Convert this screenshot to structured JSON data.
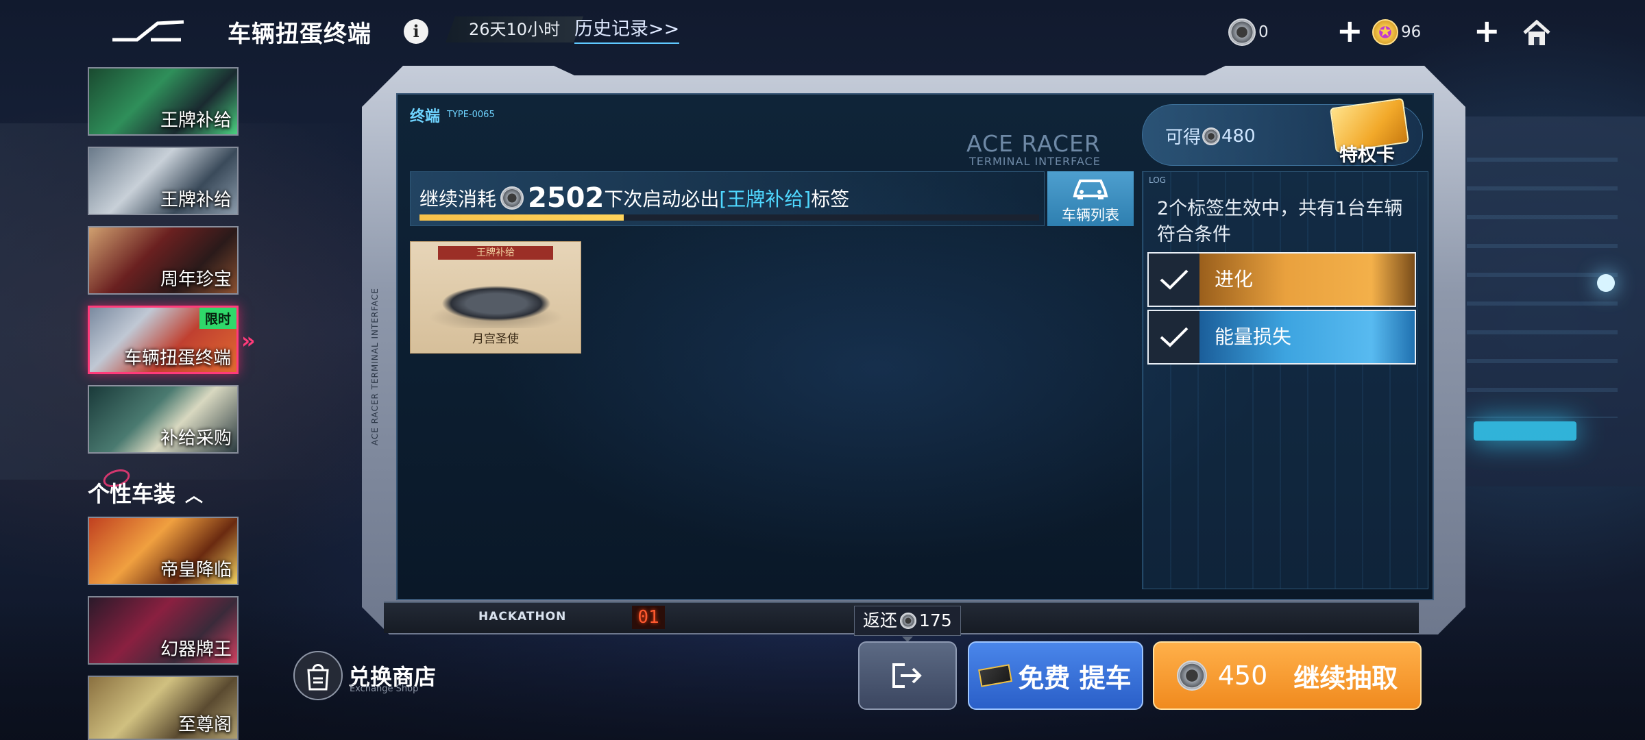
{
  "header": {
    "title": "车辆扭蛋终端",
    "timer": "26天10小时",
    "history_link": "历史记录>>",
    "coins_value": "0",
    "stars_value": "96",
    "coin_icon": "silver-coin-icon",
    "star_icon": "purple-star-coin-icon",
    "plus_symbol": "+",
    "home_icon": "home-icon"
  },
  "sidebar": {
    "items": [
      {
        "label": "王牌补给",
        "active": false
      },
      {
        "label": "王牌补给",
        "active": false
      },
      {
        "label": "周年珍宝",
        "active": false
      },
      {
        "label": "车辆扭蛋终端",
        "active": true,
        "tag": "限时"
      },
      {
        "label": "补给采购",
        "active": false
      }
    ],
    "section_title": "个性车装",
    "section_items": [
      {
        "label": "帝皇降临"
      },
      {
        "label": "幻器牌王"
      },
      {
        "label": "至尊阁"
      }
    ],
    "active_arrow": "»"
  },
  "terminal": {
    "title": "终端",
    "type_code": "TYPE-0065",
    "brand_big": "ACE RACER",
    "brand_small": "TERMINAL INTERFACE",
    "vertical_text": "ACE RACER TERMINAL INTERFACE",
    "bottom_label": "HACKATHON",
    "bottom_digits": "01",
    "progress": {
      "prefix": "继续消耗",
      "amount": "2502",
      "middle": "下次启动必出",
      "highlight": "[王牌补给]",
      "suffix": "标签",
      "fill_fraction": 0.33
    },
    "car_list_button": "车辆列表",
    "card": {
      "tag": "王牌补给",
      "name": "月宫圣使"
    }
  },
  "right_panel": {
    "available_prefix": "可得",
    "available_amount": "480",
    "vip_label": "特权卡",
    "log_label": "LOG",
    "log_text": "2个标签生效中，共有1台车辆符合条件",
    "conditions": [
      {
        "label": "进化",
        "color": "#e9a13e"
      },
      {
        "label": "能量损失",
        "color": "#3da4e0"
      }
    ]
  },
  "actions": {
    "shop_label": "兑换商店",
    "shop_sub": "Exchange Shop",
    "refund_prefix": "返还",
    "refund_amount": "175",
    "free_label": "免费 提车",
    "draw_amount": "450",
    "draw_label": "继续抽取"
  },
  "colors": {
    "accent_pink": "#ff3b7a",
    "accent_cyan": "#4fd8ff",
    "progress_yellow": "#f7c14a",
    "button_orange": "#f08a1e",
    "button_blue": "#2a5fc8"
  }
}
